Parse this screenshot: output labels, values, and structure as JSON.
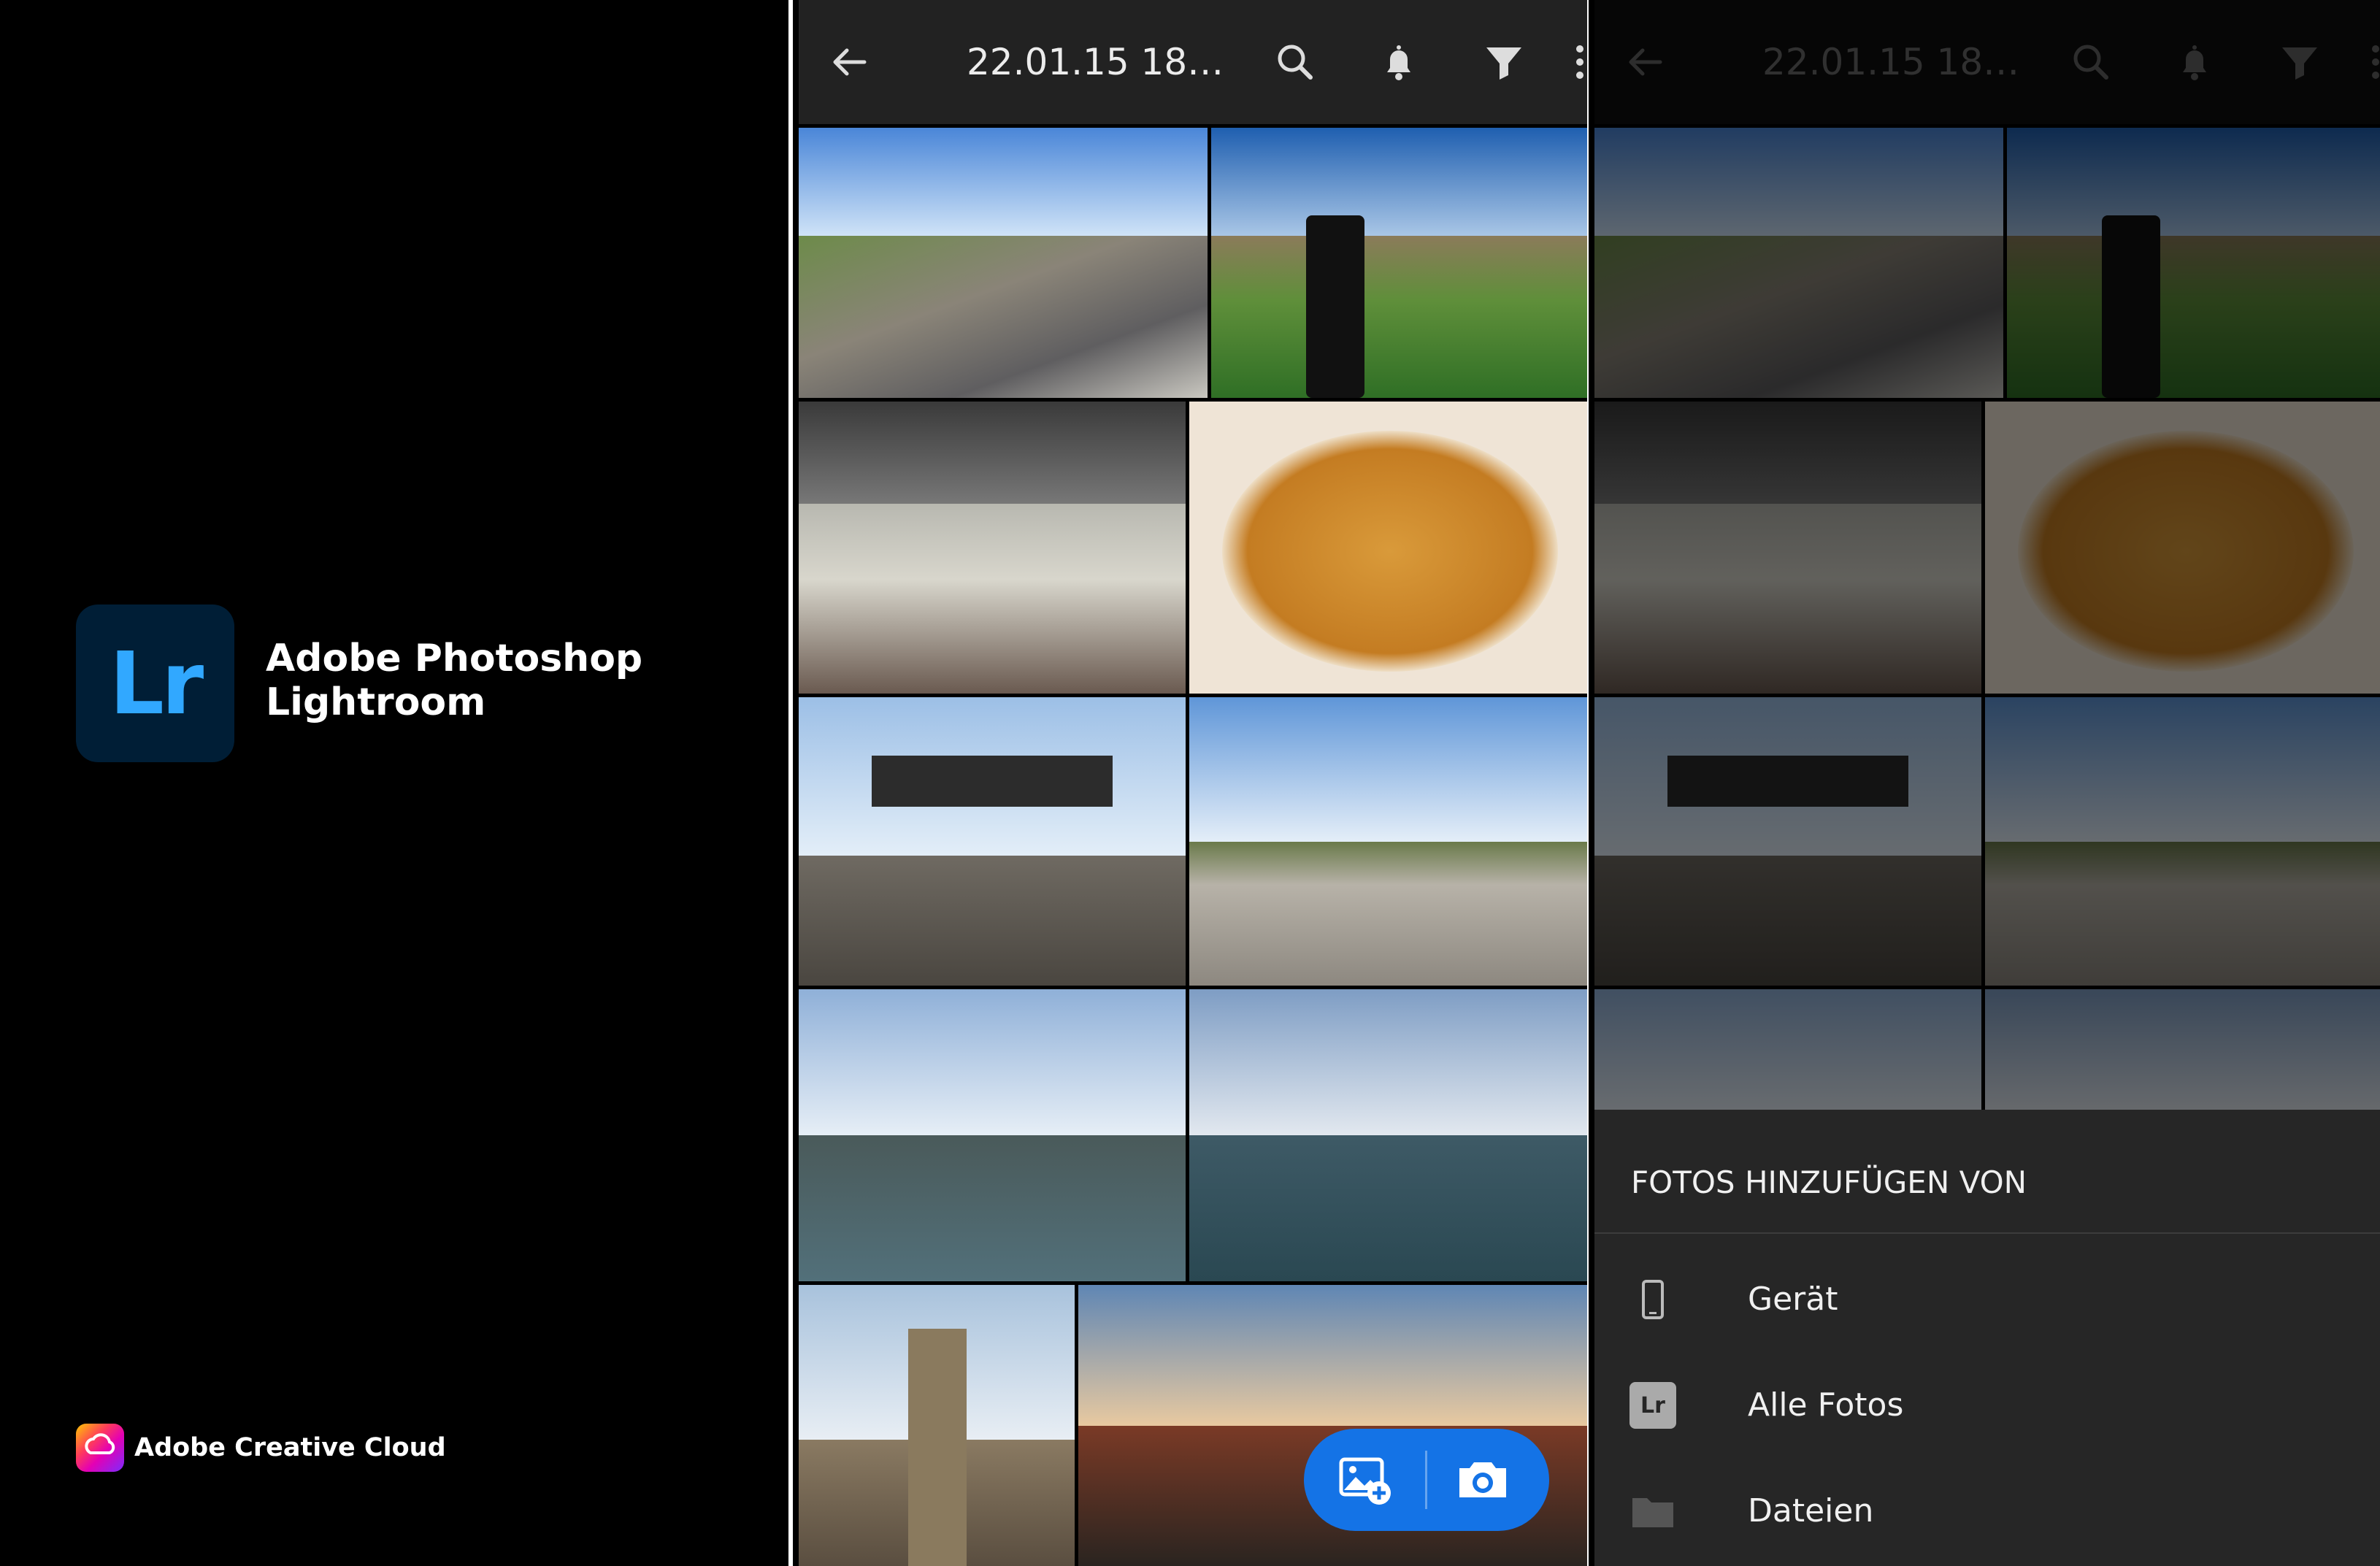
{
  "splash": {
    "logo_text": "Lr",
    "app_name_line1": "Adobe Photoshop",
    "app_name_line2": "Lightroom",
    "brand": "Adobe Creative Cloud",
    "logo_bg": "#001e36",
    "logo_fg": "#31a8ff"
  },
  "album": {
    "title": "22.01.15 18…",
    "icons": [
      "back-arrow-icon",
      "search-icon",
      "bell-icon",
      "filter-icon",
      "more-vertical-icon"
    ]
  },
  "fab": {
    "icons": [
      "add-photo-icon",
      "camera-icon"
    ],
    "color": "#1473e6"
  },
  "sheet": {
    "title": "FOTOS HINZUFÜGEN VON",
    "items": [
      {
        "label": "Gerät",
        "icon": "phone-device-icon"
      },
      {
        "label": "Alle Fotos",
        "icon": "lightroom-icon",
        "icon_text": "Lr"
      },
      {
        "label": "Dateien",
        "icon": "folder-icon"
      }
    ]
  }
}
